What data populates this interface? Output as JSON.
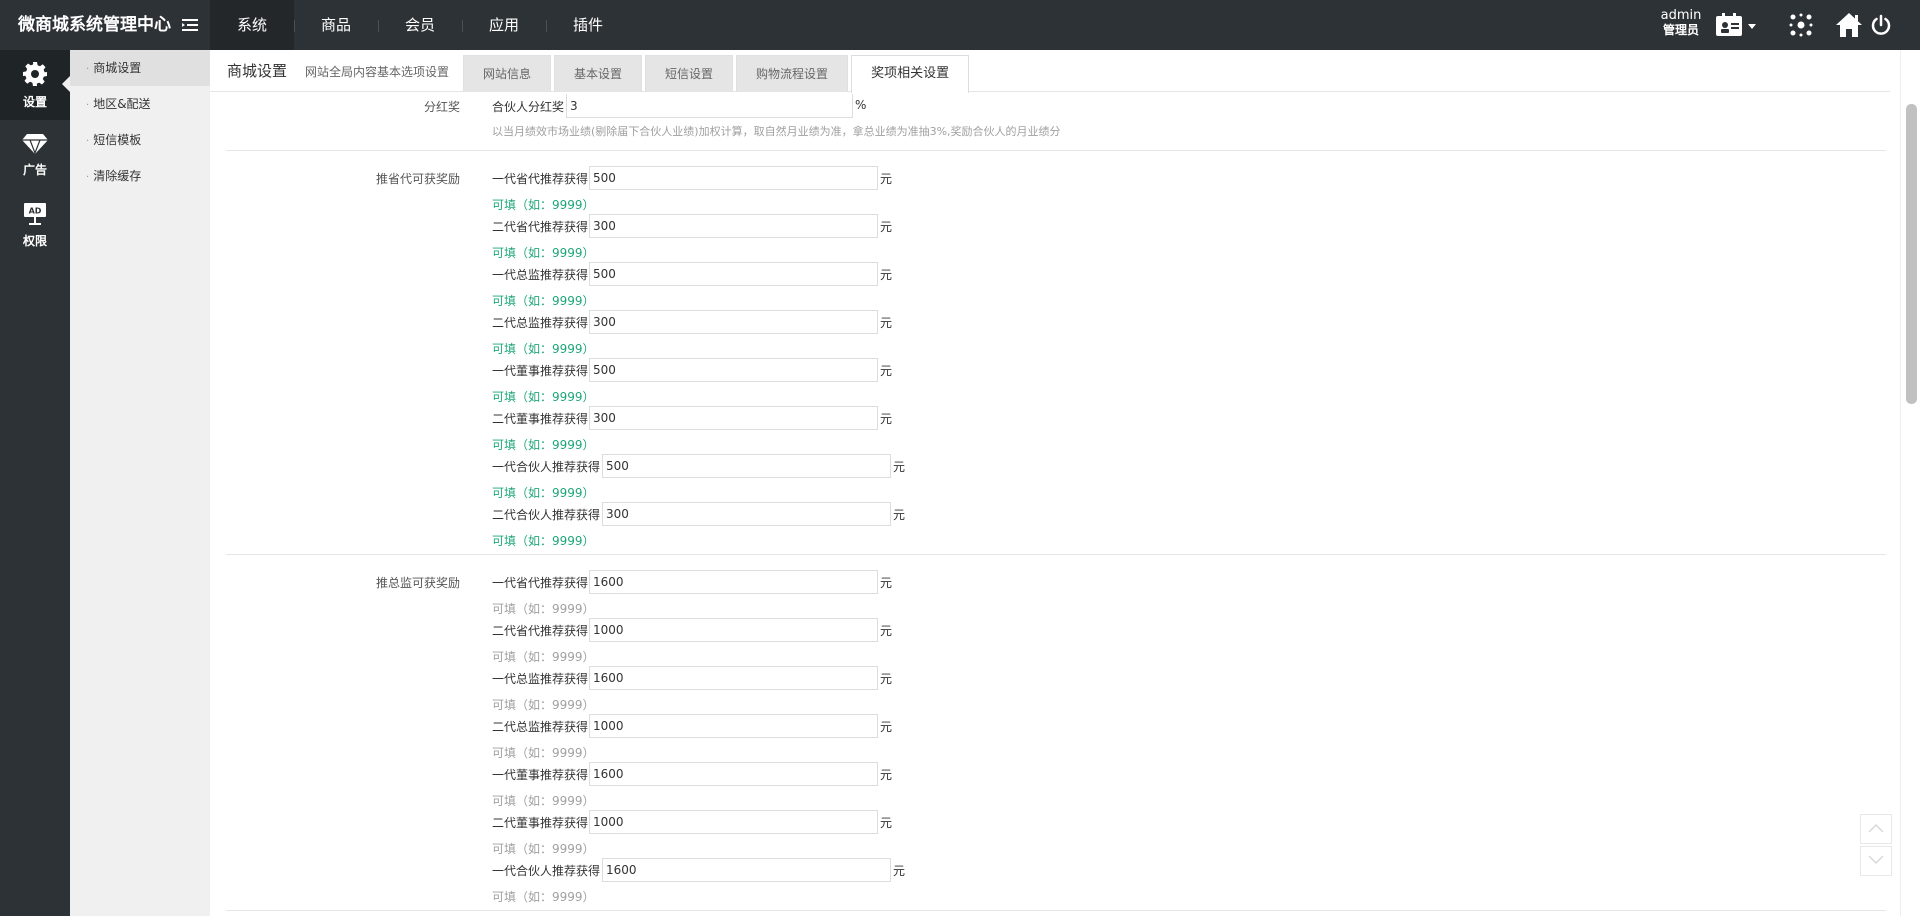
{
  "header": {
    "brand": "微商城系统管理中心",
    "nav": [
      "系统",
      "商品",
      "会员",
      "应用",
      "插件"
    ],
    "user_name": "admin",
    "user_role": "管理员"
  },
  "iconbar": [
    {
      "label": "设置",
      "icon": "gear-icon"
    },
    {
      "label": "广告",
      "icon": "diamond-icon"
    },
    {
      "label": "权限",
      "icon": "ad-board-icon"
    }
  ],
  "subnav": [
    "商城设置",
    "地区&配送",
    "短信模板",
    "清除缓存"
  ],
  "page": {
    "title": "商城设置",
    "subtitle": "网站全局内容基本选项设置",
    "tabs": [
      "网站信息",
      "基本设置",
      "短信设置",
      "购物流程设置",
      "奖项相关设置"
    ],
    "active_tab": "奖项相关设置"
  },
  "dividend": {
    "label": "分红奖",
    "input_label": "合伙人分红奖",
    "value": "3",
    "unit": "%",
    "hint": "以当月绩效市场业绩(剔除届下合伙人业绩)加权计算，取自然月业绩为准，拿总业绩为准抽3%,奖励合伙人的月业绩分"
  },
  "groups": [
    {
      "label": "推省代可获奖励",
      "hint_style": "green",
      "rows": [
        {
          "label": "一代省代推荐获得",
          "value": "500",
          "unit": "元",
          "hint": "可填（如：9999）"
        },
        {
          "label": "二代省代推荐获得",
          "value": "300",
          "unit": "元",
          "hint": "可填（如：9999）"
        },
        {
          "label": "一代总监推荐获得",
          "value": "500",
          "unit": "元",
          "hint": "可填（如：9999）"
        },
        {
          "label": "二代总监推荐获得",
          "value": "300",
          "unit": "元",
          "hint": "可填（如：9999）"
        },
        {
          "label": "一代董事推荐获得",
          "value": "500",
          "unit": "元",
          "hint": "可填（如：9999）"
        },
        {
          "label": "二代董事推荐获得",
          "value": "300",
          "unit": "元",
          "hint": "可填（如：9999）"
        },
        {
          "label": "一代合伙人推荐获得",
          "value": "500",
          "unit": "元",
          "hint": "可填（如：9999）"
        },
        {
          "label": "二代合伙人推荐获得",
          "value": "300",
          "unit": "元",
          "hint": "可填（如：9999）"
        }
      ]
    },
    {
      "label": "推总监可获奖励",
      "hint_style": "gray",
      "rows": [
        {
          "label": "一代省代推荐获得",
          "value": "1600",
          "unit": "元",
          "hint": "可填（如：9999）"
        },
        {
          "label": "二代省代推荐获得",
          "value": "1000",
          "unit": "元",
          "hint": "可填（如：9999）"
        },
        {
          "label": "一代总监推荐获得",
          "value": "1600",
          "unit": "元",
          "hint": "可填（如：9999）"
        },
        {
          "label": "二代总监推荐获得",
          "value": "1000",
          "unit": "元",
          "hint": "可填（如：9999）"
        },
        {
          "label": "一代董事推荐获得",
          "value": "1600",
          "unit": "元",
          "hint": "可填（如：9999）"
        },
        {
          "label": "二代董事推荐获得",
          "value": "1000",
          "unit": "元",
          "hint": "可填（如：9999）"
        },
        {
          "label": "一代合伙人推荐获得",
          "value": "1600",
          "unit": "元",
          "hint": "可填（如：9999）"
        }
      ]
    }
  ]
}
